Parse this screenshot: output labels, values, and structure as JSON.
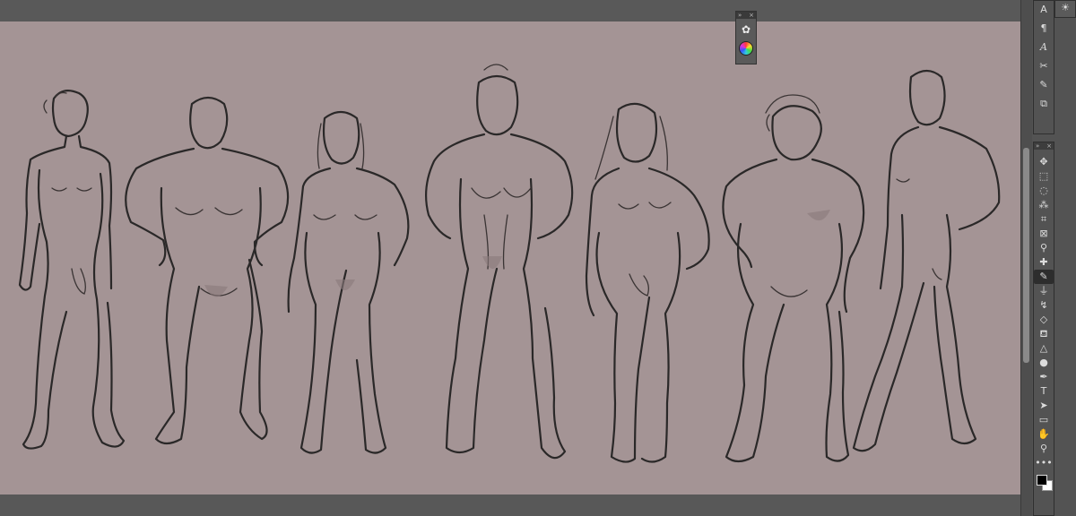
{
  "app": {
    "accent": "#2d2d2d",
    "canvas_color": "#a49495",
    "panel_color": "#535353"
  },
  "upper_panel": {
    "tools": [
      {
        "icon": "character-panel-icon",
        "glyph": "A|"
      },
      {
        "icon": "paragraph-panel-icon",
        "glyph": "¶"
      },
      {
        "icon": "glyph-panel-icon",
        "glyph": "𝐴"
      },
      {
        "icon": "tool-presets-icon",
        "glyph": "✂"
      },
      {
        "icon": "brush-settings-icon",
        "glyph": "🖌"
      },
      {
        "icon": "clone-source-icon",
        "glyph": "⧉"
      }
    ],
    "top_right_icon": "sun-brightness-icon"
  },
  "float_panel": {
    "items": [
      {
        "icon": "palette-icon"
      },
      {
        "icon": "color-wheel-icon"
      }
    ]
  },
  "toolbar": {
    "tools": [
      {
        "icon": "move-tool-icon",
        "glyph": "✥"
      },
      {
        "icon": "marquee-tool-icon",
        "glyph": "⬚"
      },
      {
        "icon": "lasso-tool-icon",
        "glyph": "◌"
      },
      {
        "icon": "magic-wand-tool-icon",
        "glyph": "⁂"
      },
      {
        "icon": "crop-tool-icon",
        "glyph": "⌗"
      },
      {
        "icon": "frame-tool-icon",
        "glyph": "⊠"
      },
      {
        "icon": "eyedropper-tool-icon",
        "glyph": "⚲"
      },
      {
        "icon": "healing-brush-tool-icon",
        "glyph": "✚"
      },
      {
        "icon": "brush-tool-icon",
        "glyph": "✎",
        "active": true
      },
      {
        "icon": "clone-stamp-tool-icon",
        "glyph": "⏚"
      },
      {
        "icon": "history-brush-tool-icon",
        "glyph": "↯"
      },
      {
        "icon": "eraser-tool-icon",
        "glyph": "◇"
      },
      {
        "icon": "paint-bucket-tool-icon",
        "glyph": "⛾"
      },
      {
        "icon": "blur-tool-icon",
        "glyph": "△"
      },
      {
        "icon": "dodge-tool-icon",
        "glyph": "●"
      },
      {
        "icon": "pen-tool-icon",
        "glyph": "✒"
      },
      {
        "icon": "type-tool-icon",
        "glyph": "T"
      },
      {
        "icon": "path-selection-tool-icon",
        "glyph": "➤"
      },
      {
        "icon": "rectangle-tool-icon",
        "glyph": "▭"
      },
      {
        "icon": "hand-tool-icon",
        "glyph": "✋"
      },
      {
        "icon": "zoom-tool-icon",
        "glyph": "⚲"
      },
      {
        "icon": "more-tools-icon",
        "glyph": "•••"
      }
    ],
    "foreground_color": "#000000",
    "background_color": "#ffffff"
  }
}
